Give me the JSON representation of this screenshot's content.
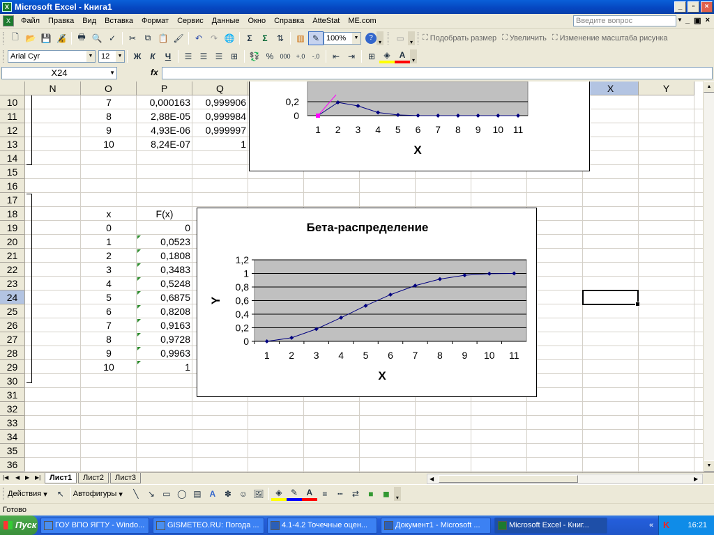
{
  "window": {
    "title": "Microsoft Excel - Книга1",
    "app_icon": "excel-icon"
  },
  "menu": {
    "items": [
      "Файл",
      "Правка",
      "Вид",
      "Вставка",
      "Формат",
      "Сервис",
      "Данные",
      "Окно",
      "Справка",
      "AtteStat",
      "ME.com"
    ],
    "question_placeholder": "Введите вопрос"
  },
  "toolbar_standard": {
    "zoom": "100%",
    "fit_size": "Подобрать размер",
    "zoom_in": "Увеличить",
    "change_picture_scale": "Изменение масштаба рисунка"
  },
  "toolbar_format": {
    "font": "Arial Cyr",
    "size": "12",
    "bold": "Ж",
    "italic": "К",
    "underline": "Ч",
    "percent": "%",
    "thousands": "000"
  },
  "formula_bar": {
    "name_box": "X24",
    "fx": "fx",
    "value": ""
  },
  "columns": [
    {
      "letter": "N"
    },
    {
      "letter": "O"
    },
    {
      "letter": "P"
    },
    {
      "letter": "Q"
    },
    {
      "letter": "R"
    },
    {
      "letter": "S"
    },
    {
      "letter": "T"
    },
    {
      "letter": "U"
    },
    {
      "letter": "V"
    },
    {
      "letter": "W"
    },
    {
      "letter": "X"
    },
    {
      "letter": "Y"
    }
  ],
  "rows": [
    "10",
    "11",
    "12",
    "13",
    "14",
    "15",
    "16",
    "17",
    "18",
    "19",
    "20",
    "21",
    "22",
    "23",
    "24",
    "25",
    "26",
    "27",
    "28",
    "29",
    "30",
    "31",
    "32",
    "33",
    "34",
    "35",
    "36"
  ],
  "selected_column": "X",
  "selected_row": "24",
  "table_top": {
    "rows": [
      {
        "o": "7",
        "p": "0,000163",
        "q": "0,999906"
      },
      {
        "o": "8",
        "p": "2,88E-05",
        "q": "0,999984"
      },
      {
        "o": "9",
        "p": "4,93E-06",
        "q": "0,999997"
      },
      {
        "o": "10",
        "p": "8,24E-07",
        "q": "1"
      }
    ]
  },
  "table_bottom": {
    "header_x": "x",
    "header_fx": "F(x)",
    "rows": [
      {
        "x": "0",
        "fx": "0"
      },
      {
        "x": "1",
        "fx": "0,0523"
      },
      {
        "x": "2",
        "fx": "0,1808"
      },
      {
        "x": "3",
        "fx": "0,3483"
      },
      {
        "x": "4",
        "fx": "0,5248"
      },
      {
        "x": "5",
        "fx": "0,6875"
      },
      {
        "x": "6",
        "fx": "0,8208"
      },
      {
        "x": "7",
        "fx": "0,9163"
      },
      {
        "x": "8",
        "fx": "0,9728"
      },
      {
        "x": "9",
        "fx": "0,9963"
      },
      {
        "x": "10",
        "fx": "1"
      }
    ]
  },
  "chart_data": [
    {
      "type": "line",
      "title": "",
      "xlabel": "X",
      "ylabel": "",
      "categories": [
        "1",
        "2",
        "3",
        "4",
        "5",
        "6",
        "7",
        "8",
        "9",
        "10",
        "11"
      ],
      "ylim": [
        0,
        0.2
      ],
      "yticks_visible": [
        "0",
        "0,2"
      ],
      "series": [
        {
          "values": [
            0,
            0.19,
            0.14,
            0.045,
            0.01,
            0.0016,
            0.00016,
            3e-05,
            5e-06,
            8e-07,
            1e-07
          ],
          "color": "#000080"
        },
        {
          "values": [
            0,
            0.2
          ],
          "color": "#ff00ff"
        }
      ],
      "plot_bg": "#c0c0c0"
    },
    {
      "type": "line",
      "title": "Бета-распределение",
      "xlabel": "X",
      "ylabel": "Y",
      "categories": [
        "1",
        "2",
        "3",
        "4",
        "5",
        "6",
        "7",
        "8",
        "9",
        "10",
        "11"
      ],
      "ylim": [
        0,
        1.2
      ],
      "yticks": [
        "0",
        "0,2",
        "0,4",
        "0,6",
        "0,8",
        "1",
        "1,2"
      ],
      "series": [
        {
          "values": [
            0,
            0.0523,
            0.1808,
            0.3483,
            0.5248,
            0.6875,
            0.8208,
            0.9163,
            0.9728,
            0.9963,
            1
          ],
          "color": "#000080"
        }
      ],
      "plot_bg": "#c0c0c0",
      "grid": true
    }
  ],
  "sheet_tabs": [
    "Лист1",
    "Лист2",
    "Лист3"
  ],
  "drawing_toolbar": {
    "actions": "Действия",
    "autoshapes": "Автофигуры"
  },
  "status": "Готово",
  "taskbar": {
    "start": "Пуск",
    "buttons": [
      "ГОУ ВПО ЯГТУ - Windo...",
      "GISMETEO.RU: Погода ...",
      "4.1-4.2 Точечные оцен...",
      "Документ1 - Microsoft ...",
      "Microsoft Excel - Книг..."
    ],
    "tray_chevron": "«",
    "clock": "16:21"
  }
}
